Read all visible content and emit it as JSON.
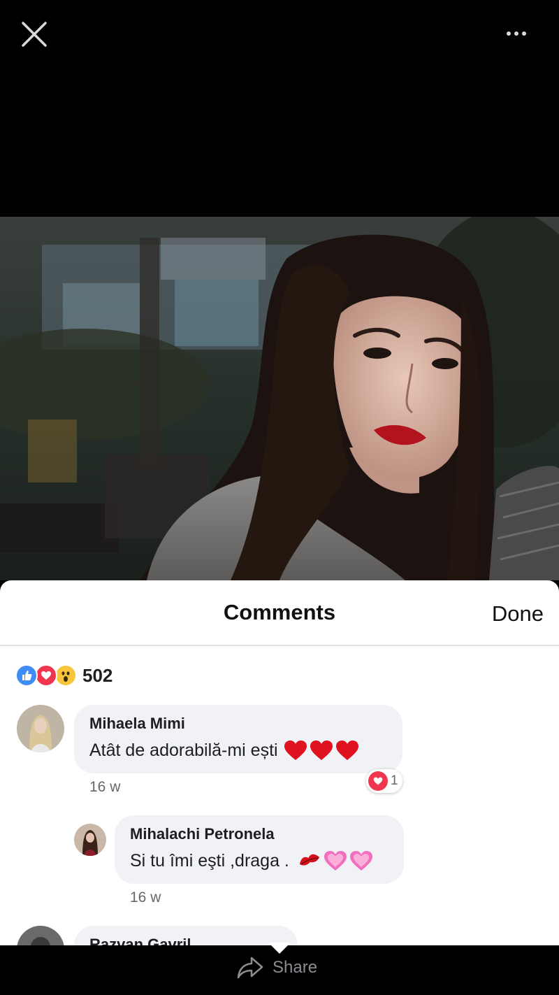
{
  "topbar": {
    "close_icon": "close-icon",
    "more_icon": "more-icon"
  },
  "sheet": {
    "title": "Comments",
    "done_label": "Done"
  },
  "reactions": {
    "icons": [
      "like-icon",
      "love-icon",
      "wow-icon"
    ],
    "count": "502"
  },
  "comments": [
    {
      "author": "Mihaela Mimi",
      "text": "Atât de adorabilă-mi ești",
      "emojis": [
        "red-heart",
        "red-heart",
        "red-heart"
      ],
      "time": "16 w",
      "reaction_count": "1"
    },
    {
      "author": "Mihalachi Petronela",
      "text": "Si tu îmi eşti ,draga .",
      "emojis": [
        "kiss-mark",
        "pink-heart",
        "pink-heart"
      ],
      "time": "16 w"
    },
    {
      "author": "Razvan Gavril"
    }
  ],
  "bottom": {
    "share_label": "Share"
  },
  "colors": {
    "like": "#3f8cf7",
    "love": "#f0364f",
    "wow": "#f8c63c",
    "bubble": "#f0f2f5"
  }
}
